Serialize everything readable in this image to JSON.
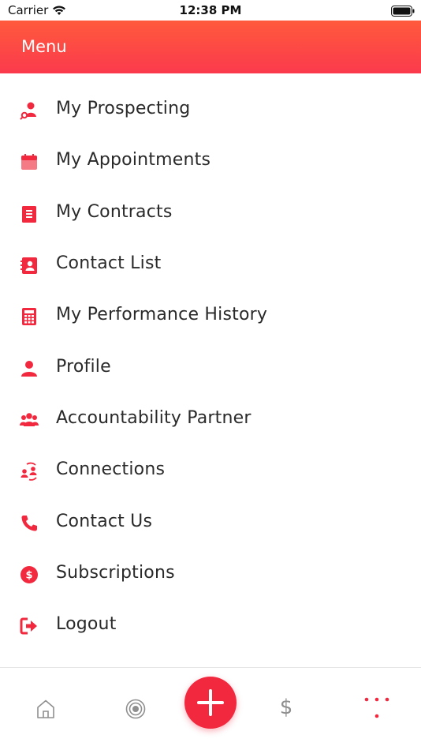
{
  "status_bar": {
    "carrier": "Carrier",
    "time": "12:38 PM"
  },
  "header": {
    "title": "Menu"
  },
  "menu": {
    "items": [
      {
        "label": "My Prospecting",
        "icon": "user-search-icon"
      },
      {
        "label": "My Appointments",
        "icon": "calendar-icon"
      },
      {
        "label": "My Contracts",
        "icon": "document-icon"
      },
      {
        "label": "Contact List",
        "icon": "contact-book-icon"
      },
      {
        "label": "My Performance History",
        "icon": "calculator-icon"
      },
      {
        "label": "Profile",
        "icon": "user-icon"
      },
      {
        "label": "Accountability Partner",
        "icon": "group-icon"
      },
      {
        "label": "Connections",
        "icon": "connections-icon"
      },
      {
        "label": "Contact Us",
        "icon": "phone-icon"
      },
      {
        "label": "Subscriptions",
        "icon": "dollar-circle-icon"
      },
      {
        "label": "Logout",
        "icon": "logout-icon"
      }
    ]
  },
  "tabbar": {
    "dollar_symbol": "$",
    "tabs": [
      "home-icon",
      "target-icon",
      "add-icon",
      "dollar-icon",
      "more-icon"
    ]
  },
  "colors": {
    "accent": "#f2283e",
    "header_top": "#ff5a3c",
    "header_bottom": "#fb3a4d",
    "icon_gray": "#8f8f8f"
  }
}
